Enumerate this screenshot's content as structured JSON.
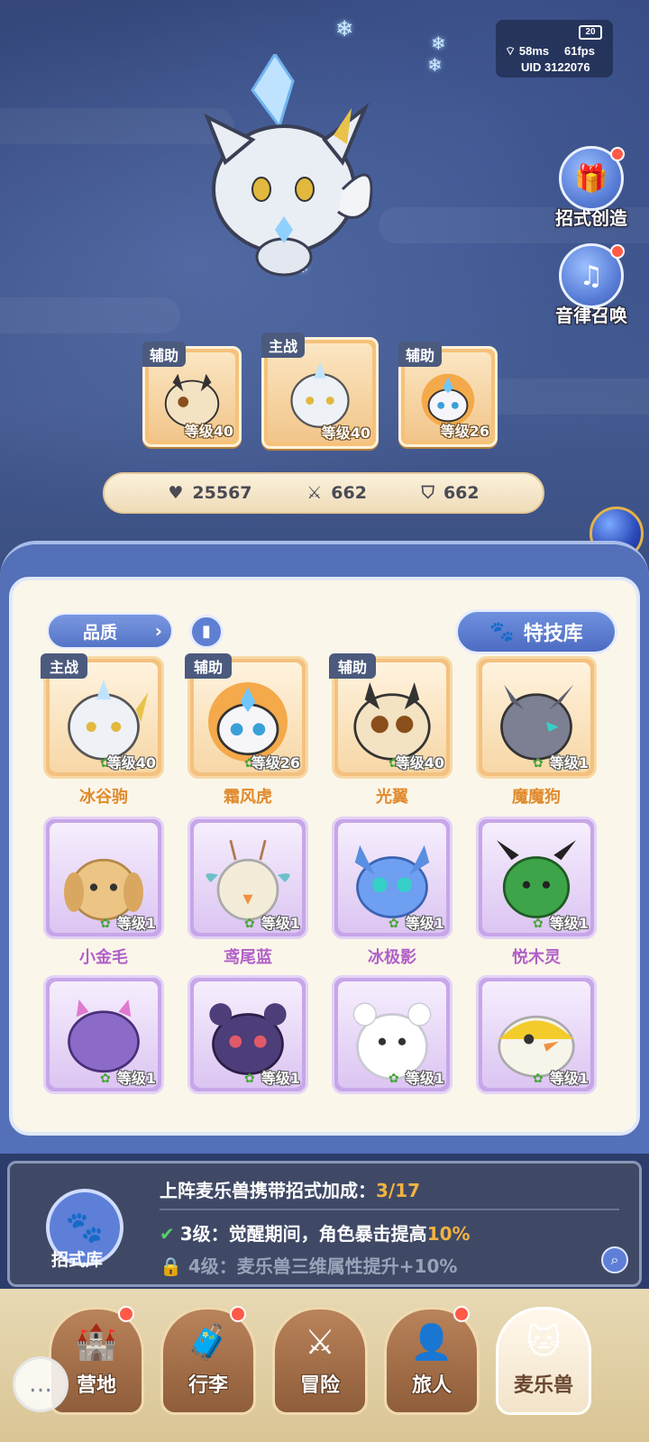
{
  "status": {
    "battery": "20",
    "ping": "58ms",
    "fps": "61fps",
    "uid": "UID  3122076"
  },
  "side_buttons": [
    {
      "label": "招式创造",
      "icon": "music-box-icon"
    },
    {
      "label": "音律召唤",
      "icon": "lyre-icon"
    }
  ],
  "team": [
    {
      "tag": "辅助",
      "level": "等级40"
    },
    {
      "tag": "主战",
      "level": "等级40"
    },
    {
      "tag": "辅助",
      "level": "等级26"
    }
  ],
  "stats": {
    "hp": "25567",
    "attack": "662",
    "defense": "662"
  },
  "filter": {
    "label": "品质",
    "skill_library": "特技库"
  },
  "creatures": [
    {
      "name": "冰谷驹",
      "level": "等级40",
      "tag": "主战",
      "quality": "gold"
    },
    {
      "name": "霜风虎",
      "level": "等级26",
      "tag": "辅助",
      "quality": "gold"
    },
    {
      "name": "光翼",
      "level": "等级40",
      "tag": "辅助",
      "quality": "gold"
    },
    {
      "name": "魔魔狗",
      "level": "等级1",
      "tag": "",
      "quality": "gold"
    },
    {
      "name": "小金毛",
      "level": "等级1",
      "tag": "",
      "quality": "purple"
    },
    {
      "name": "鸢尾蓝",
      "level": "等级1",
      "tag": "",
      "quality": "purple"
    },
    {
      "name": "冰极影",
      "level": "等级1",
      "tag": "",
      "quality": "purple"
    },
    {
      "name": "悦木灵",
      "level": "等级1",
      "tag": "",
      "quality": "purple"
    },
    {
      "name": "",
      "level": "等级1",
      "tag": "",
      "quality": "purple"
    },
    {
      "name": "",
      "level": "等级1",
      "tag": "",
      "quality": "purple"
    },
    {
      "name": "",
      "level": "等级1",
      "tag": "",
      "quality": "purple"
    },
    {
      "name": "",
      "level": "等级1",
      "tag": "",
      "quality": "purple"
    }
  ],
  "bonus": {
    "lib_label": "招式库",
    "title": "上阵麦乐兽携带招式加成：",
    "progress": "3/17",
    "line1_prefix": "3级：觉醒期间，角色暴击提高",
    "line1_pct": "10%",
    "line2": "4级：麦乐兽三维属性提升+10%"
  },
  "nav": [
    {
      "label": "营地",
      "icon": "castle-icon"
    },
    {
      "label": "行李",
      "icon": "chest-icon"
    },
    {
      "label": "冒险",
      "icon": "crossed-swords-icon"
    },
    {
      "label": "旅人",
      "icon": "traveler-icon"
    },
    {
      "label": "麦乐兽",
      "icon": "creature-icon"
    }
  ],
  "colors": {
    "gold_name": "#e08a2c",
    "purple_name": "#b060c8",
    "accent": "#f3b240"
  }
}
